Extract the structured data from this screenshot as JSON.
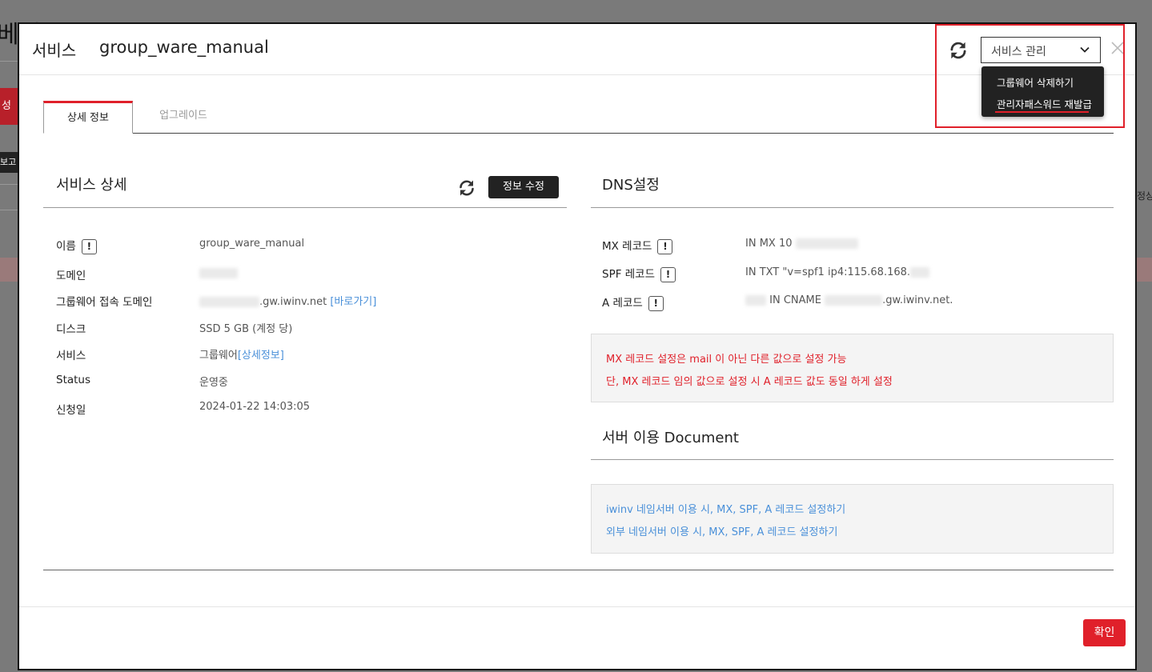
{
  "backdrop": {
    "title_fragment": "베인",
    "button_fragment": "성하",
    "dark_fragment": "보고",
    "right_fragment": "정상"
  },
  "header": {
    "label": "서비스",
    "title": "group_ware_manual",
    "select_value": "서비스 관리"
  },
  "dropdown": {
    "items": [
      "그룹웨어 삭제하기",
      "관리자패스워드 재발급"
    ]
  },
  "tabs": [
    "상세 정보",
    "업그레이드"
  ],
  "service_detail": {
    "title": "서비스 상세",
    "edit_label": "정보 수정",
    "rows": [
      {
        "label": "이름",
        "value": "group_ware_manual"
      },
      {
        "label": "도메인",
        "value": ""
      },
      {
        "label": "그룹웨어 접속 도메인",
        "value": ".gw.iwinv.net",
        "link": "[바로가기]"
      },
      {
        "label": "디스크",
        "value": "SSD  5  GB (계정 당)"
      },
      {
        "label": "서비스",
        "value": "그룹웨어",
        "link": "[상세정보]"
      },
      {
        "label": "Status",
        "value": "운영중"
      },
      {
        "label": "신청일",
        "value": "2024-01-22 14:03:05"
      }
    ]
  },
  "dns": {
    "title": "DNS설정",
    "rows": [
      {
        "label": "MX 레코드",
        "value": "IN MX 10"
      },
      {
        "label": "SPF 레코드",
        "value": "IN TXT \"v=spf1 ip4:115.68.168."
      },
      {
        "label": "A 레코드",
        "value": "IN CNAME",
        "suffix": ".gw.iwinv.net."
      }
    ],
    "notices": [
      "MX 레코드 설정은 mail 이 아닌 다른 값으로 설정 가능",
      "단, MX 레코드 임의 값으로 설정 시 A 레코드 값도 동일 하게 설정"
    ]
  },
  "document": {
    "title": "서버 이용 Document",
    "links": [
      "iwinv 네임서버 이용 시, MX, SPF, A 레코드 설정하기",
      "외부 네임서버 이용 시, MX, SPF, A 레코드 설정하기"
    ]
  },
  "footer": {
    "confirm_label": "확인"
  },
  "colors": {
    "accent_red": "#e0202a",
    "link_blue": "#4a90d9",
    "dark": "#222222"
  }
}
